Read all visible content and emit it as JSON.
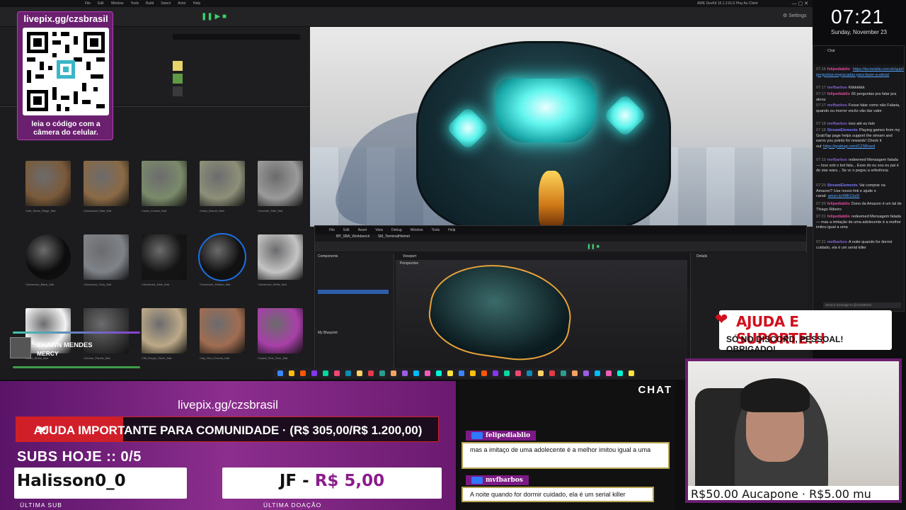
{
  "qr": {
    "url": "livepix.gg/czsbrasil",
    "caption": "leia o código com a câmera do celular."
  },
  "clock": {
    "time": "07:21",
    "date": "Sunday, November 23"
  },
  "now_playing": {
    "title": "SHAWN MENDES",
    "artist": "MERCY"
  },
  "editor": {
    "menu": [
      "File",
      "Edit",
      "Window",
      "Tools",
      "Build",
      "Select",
      "Actor",
      "Help"
    ],
    "title": "AWE DevKit 16.1.3 ELS Play As Client",
    "bp_menu": [
      "File",
      "Edit",
      "Asset",
      "View",
      "Debug",
      "Window",
      "Tools",
      "Help"
    ],
    "bp_tabs": [
      "BP_SBA_Workbench",
      "SM_TerminalHelmet"
    ],
    "components_label": "Components",
    "viewport_label": "Viewport",
    "perspective_label": "Perspective",
    "my_blueprint_label": "My Blueprint",
    "details_label": "Details"
  },
  "chat_side": {
    "title": "Chat",
    "messages": [
      {
        "time": "07:16",
        "user": "felipediablio",
        "color": "#e64a9d",
        "text": "",
        "link": "https://tecmobile.com.br/quiz/65-perguntas-engracadas-para-fazer-a-alexa/"
      },
      {
        "time": "07:17",
        "user": "mvfbarbos",
        "color": "#8a63d2",
        "text": "Kkkkkkkk"
      },
      {
        "time": "07:17",
        "user": "felipediablio",
        "color": "#e64a9d",
        "text": "65 perguntas pra falar pra alexa"
      },
      {
        "time": "07:17",
        "user": "mvfbarbos",
        "color": "#8a63d2",
        "text": "Fosse falar como não Falaria, quando eu morrer vocês vão dar valor"
      },
      {
        "time": "07:18",
        "user": "mvfbarbos",
        "color": "#8a63d2",
        "text": "isso até eu falo"
      },
      {
        "time": "07:18",
        "user": "StreamElements",
        "color": "#7b79ff",
        "text": "Playing games from my GrabTap page helps support the stream and earns you points for rewards! Check it out",
        "link": "https://grabtap.com/CZSBrasil"
      },
      {
        "time": "07:19",
        "user": "mvfbarbos",
        "color": "#8a63d2",
        "text": "redeemed Mensagem falada — Isso sob o bot fala... Esse do eu sou eu pai é do star wars... Se vc n pegou a referência"
      },
      {
        "time": "07:20",
        "user": "StreamElements",
        "color": "#7b79ff",
        "text": "Vai comprar na Amazon? Use nosso link e ajude o canal:",
        "link": "amzn.to/48KCbzD"
      },
      {
        "time": "07:20",
        "user": "felipediablio",
        "color": "#e64a9d",
        "text": "Dono da Amazon é um tal de Thiago Ribeiro"
      },
      {
        "time": "07:21",
        "user": "felipediablio",
        "color": "#e64a9d",
        "text": "redeemed Mensagem falada — mas a imitação de uma adolecente é a melhor imitou igual a uma"
      },
      {
        "time": "07:21",
        "user": "mvfbarbos",
        "color": "#8a63d2",
        "text": "A noite quando for dormir cuidado, ela é um serial killer"
      }
    ],
    "input_placeholder": "Send a message to @CZSBrasil"
  },
  "bottom": {
    "livepix_url": "livepix.gg/czsbrasil",
    "goal_text": "AJUDA IMPORTANTE PARA COMUNIDADE · (R$ 305,00/R$ 1.200,00)",
    "goal_current": 305,
    "goal_total": 1200,
    "subs_today": "SUBS HOJE :: 0/5",
    "last_sub_name": "Halisson0_0",
    "last_sub_label": "ÚLTIMA SUB",
    "last_donation_name": "JF - ",
    "last_donation_amount": "R$ 5,00",
    "last_donation_label": "ÚLTIMA DOAÇÃO"
  },
  "chat_overlay": {
    "title": "CHAT",
    "messages": [
      {
        "user": "felipediablio",
        "text": "mas a imitaço de uma adolecente é a melhor imitou igual a uma"
      },
      {
        "user": "mvfbarbos",
        "text": "A noite quando for dormir cuidado, ela é um serial killer"
      }
    ]
  },
  "help_badge": {
    "title": "AJUDA E SUPORTE!!!",
    "subtitle": "SÓ NO DISCORD, PESSOAL! OBRIGADO!"
  },
  "ticker": {
    "text": "R$50.00    Aucapone · R$5.00    mu"
  },
  "assets": [
    {
      "label": "Cleft_Stone_Ridge_Mat",
      "color": "#7a5a3a"
    },
    {
      "label": "Cedarwood_Wall_Mat",
      "color": "#8a6a45"
    },
    {
      "label": "Cedar_Leaves_Mat",
      "color": "#7a8a6a"
    },
    {
      "label": "Cedar_Branch_Mat",
      "color": "#8d8f78"
    },
    {
      "label": "Concrete_Pale_Mat",
      "color": "#9a9a9a"
    },
    {
      "label": "Checkered_Black_Mat",
      "color": "#0c0c0c"
    },
    {
      "label": "Checkered_Grey_Mat",
      "color": "#7f8388"
    },
    {
      "label": "Checkered_Dark_Mat",
      "color": "#151515"
    },
    {
      "label": "Checkered_Pattern_Mat",
      "color": "#111111"
    },
    {
      "label": "Checkered_White_Mat",
      "color": "#c4c4c4"
    },
    {
      "label": "Cloud_White_Mat",
      "color": "#f3f3f3"
    },
    {
      "label": "Chrome_Panels_Mat",
      "color": "#3a3a3a"
    },
    {
      "label": "Cliff_Rough_Stone_Mat",
      "color": "#bca987"
    },
    {
      "label": "Clay_Red_Ground_Mat",
      "color": "#a06d52"
    },
    {
      "label": "Crystal_Pink_Gem_Mat",
      "color": "#a83fa8"
    }
  ]
}
